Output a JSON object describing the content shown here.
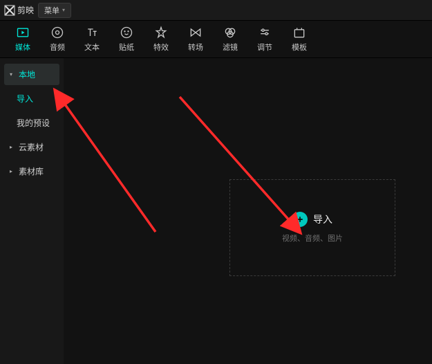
{
  "titlebar": {
    "app_name": "剪映",
    "menu_label": "菜单"
  },
  "toolbar": [
    {
      "id": "media",
      "label": "媒体",
      "active": true
    },
    {
      "id": "audio",
      "label": "音频"
    },
    {
      "id": "text",
      "label": "文本"
    },
    {
      "id": "sticker",
      "label": "贴纸"
    },
    {
      "id": "effect",
      "label": "特效"
    },
    {
      "id": "transition",
      "label": "转场"
    },
    {
      "id": "filter",
      "label": "滤镜"
    },
    {
      "id": "adjust",
      "label": "调节"
    },
    {
      "id": "template",
      "label": "模板"
    }
  ],
  "sidebar": {
    "local": {
      "label": "本地",
      "expanded": true
    },
    "import": {
      "label": "导入"
    },
    "presets": {
      "label": "我的预设"
    },
    "cloud": {
      "label": "云素材"
    },
    "library": {
      "label": "素材库"
    }
  },
  "dropzone": {
    "label": "导入",
    "subtext": "视频、音频、图片"
  },
  "colors": {
    "accent": "#00e6d8",
    "annotation": "#ff2a2a"
  }
}
